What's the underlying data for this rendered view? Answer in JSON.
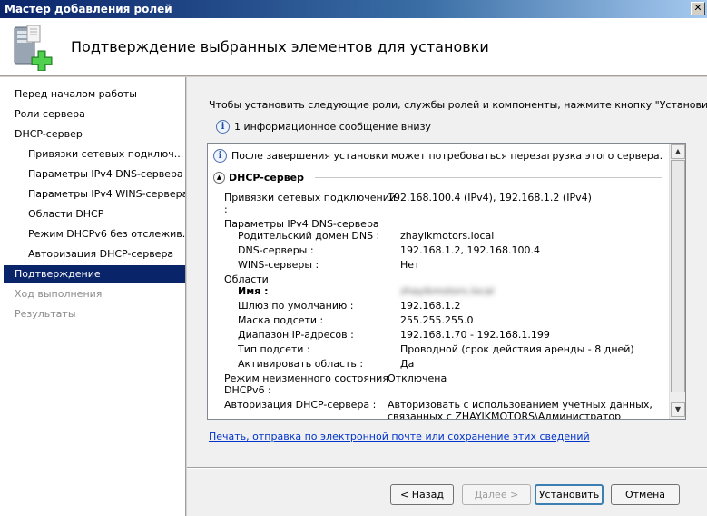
{
  "window": {
    "title": "Мастер добавления ролей"
  },
  "header": {
    "title": "Подтверждение выбранных элементов для установки"
  },
  "nav": {
    "items": [
      {
        "label": "Перед началом работы"
      },
      {
        "label": "Роли сервера"
      },
      {
        "label": "DHCP-сервер"
      },
      {
        "label": "Привязки сетевых подключ..."
      },
      {
        "label": "Параметры IPv4 DNS-сервера"
      },
      {
        "label": "Параметры IPv4 WINS-сервера"
      },
      {
        "label": "Области DHCP"
      },
      {
        "label": "Режим DHCPv6 без отслежив..."
      },
      {
        "label": "Авторизация DHCP-сервера"
      },
      {
        "label": "Подтверждение"
      },
      {
        "label": "Ход выполнения"
      },
      {
        "label": "Результаты"
      }
    ]
  },
  "main": {
    "intro": "Чтобы установить следующие роли, службы ролей и компоненты, нажмите кнопку \"Установить\".",
    "info_message": "1 информационное сообщение внизу",
    "restart_note": "После завершения установки может потребоваться перезагрузка этого сервера.",
    "section_title": "DHCP-сервер",
    "rows": {
      "bindings_label_1": "Привязки сетевых подключений",
      "bindings_label_2": ":",
      "bindings_value": "192.168.100.4 (IPv4), 192.168.1.2 (IPv4)",
      "dns_group": "Параметры IPv4 DNS-сервера",
      "parent_domain_label": "Родительский домен DNS :",
      "parent_domain_value": "zhayikmotors.local",
      "dns_servers_label": "DNS-серверы :",
      "dns_servers_value": "192.168.1.2, 192.168.100.4",
      "wins_label": "WINS-серверы :",
      "wins_value": "Нет",
      "scopes_group": "Области",
      "name_label": "Имя :",
      "name_value": "zhayikmotors.local",
      "gateway_label": "Шлюз по умолчанию :",
      "gateway_value": "192.168.1.2",
      "mask_label": "Маска подсети :",
      "mask_value": "255.255.255.0",
      "range_label": "Диапазон IP-адресов :",
      "range_value": "192.168.1.70 - 192.168.1.199",
      "subnet_type_label": "Тип подсети :",
      "subnet_type_value": "Проводной (срок действия аренды - 8 дней)",
      "activate_label": "Активировать область :",
      "activate_value": "Да",
      "dhcpv6_label_1": "Режим неизменного состояния",
      "dhcpv6_label_2": "DHCPv6 :",
      "dhcpv6_value": "Отключена",
      "auth_label": "Авторизация DHCP-сервера :",
      "auth_value_1": "Авторизовать с использованием учетных данных,",
      "auth_value_2": "связанных с ZHAYIKMOTORS\\Администратор"
    },
    "link": "Печать, отправка по электронной почте или сохранение этих сведений"
  },
  "buttons": {
    "back": "< Назад",
    "next": "Далее >",
    "install": "Установить",
    "cancel": "Отмена"
  },
  "icons": {
    "header": "server-add-role-icon",
    "info": "info-icon",
    "collapse": "chevron-up-icon"
  }
}
